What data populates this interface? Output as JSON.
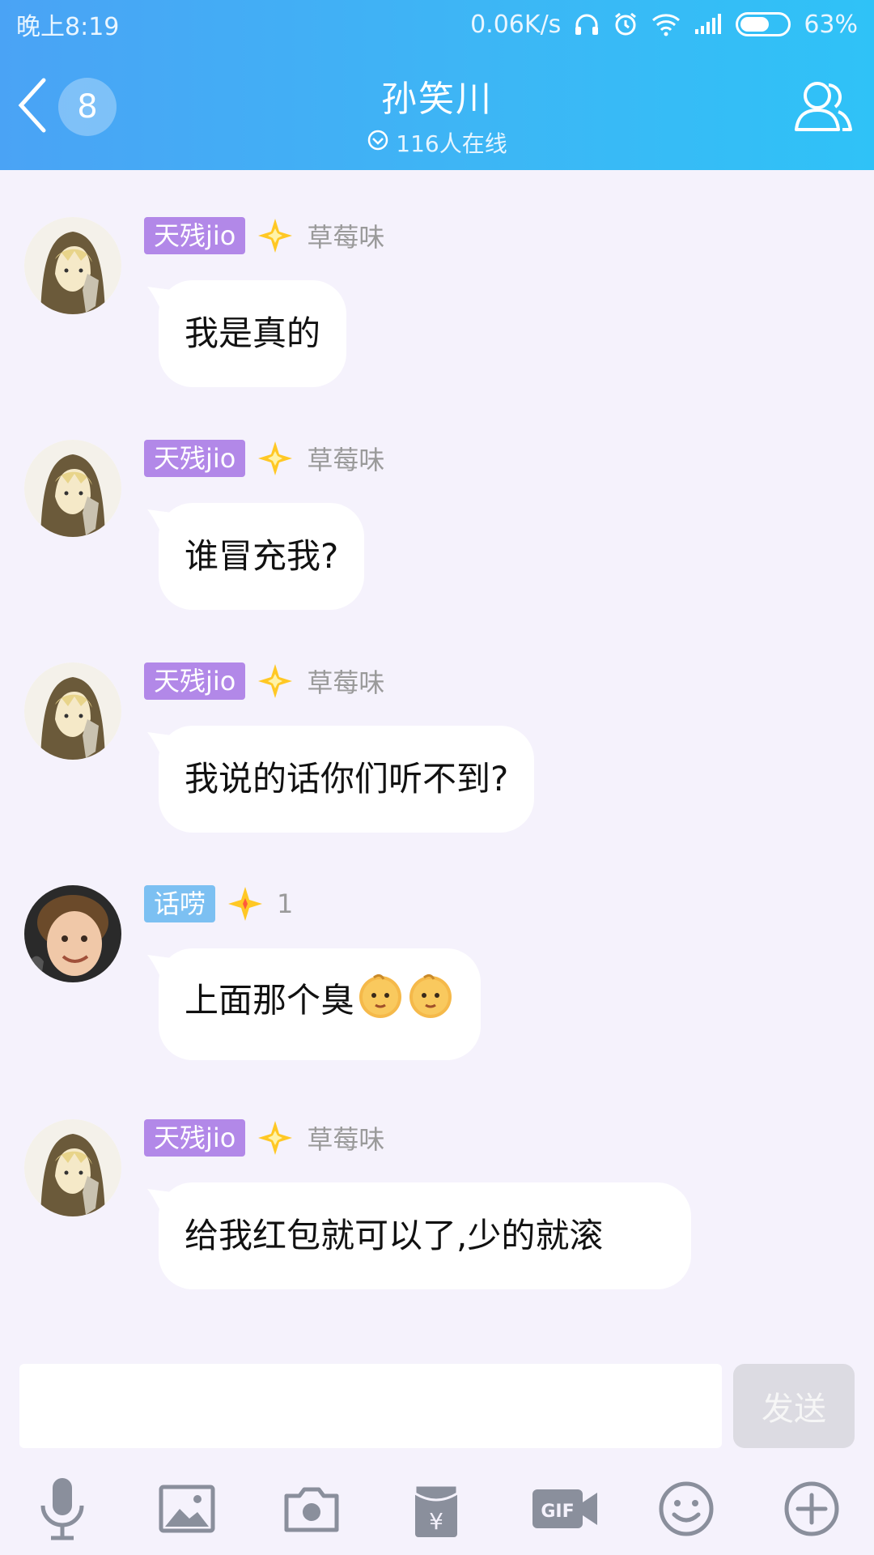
{
  "status_bar": {
    "time": "晚上8:19",
    "speed": "0.06K/s",
    "battery": "63%",
    "battery_level": 0.63
  },
  "header": {
    "unread_count": "8",
    "title": "孙笑川",
    "online": "116人在线"
  },
  "messages": [
    {
      "tag": "天残jio",
      "tag_color": "#b288e8",
      "level": "草莓味",
      "text": "我是真的"
    },
    {
      "tag": "天残jio",
      "tag_color": "#b288e8",
      "level": "草莓味",
      "text": "谁冒充我?"
    },
    {
      "tag": "天残jio",
      "tag_color": "#b288e8",
      "level": "草莓味",
      "text": "我说的话你们听不到?"
    },
    {
      "tag": "话唠",
      "tag_color": "#7cc0f2",
      "level": "1",
      "text": "上面那个臭",
      "emoji": "baby-face-icon"
    },
    {
      "tag": "天残jio",
      "tag_color": "#b288e8",
      "level": "草莓味",
      "text": "给我红包就可以了,少的就滚"
    }
  ],
  "input": {
    "placeholder": "",
    "send_label": "发送"
  },
  "toolbar": [
    "microphone-icon",
    "image-icon",
    "camera-icon",
    "red-packet-icon",
    "gif-icon",
    "smiley-icon",
    "plus-icon"
  ],
  "colors": {
    "header_start": "#4aa3f5",
    "header_end": "#2fc2f7",
    "background": "#f5f2fc"
  }
}
